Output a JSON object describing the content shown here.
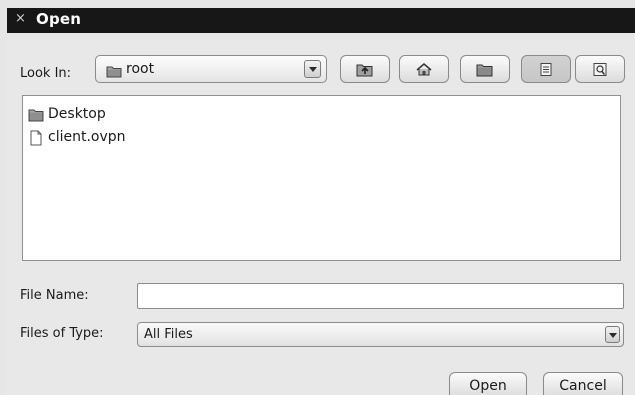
{
  "window": {
    "close_glyph": "×",
    "title": "Open"
  },
  "toolbar": {
    "look_in_label": "Look In:",
    "look_in_value": "root",
    "look_in_icon": "folder-icon",
    "buttons": [
      {
        "name": "up-one-level-button",
        "icon": "folder-up-icon"
      },
      {
        "name": "home-button",
        "icon": "home-icon"
      },
      {
        "name": "new-folder-button",
        "icon": "new-folder-icon"
      },
      {
        "name": "list-view-button",
        "icon": "list-view-icon",
        "pressed": true
      },
      {
        "name": "details-view-button",
        "icon": "details-view-icon"
      }
    ]
  },
  "files": [
    {
      "name": "Desktop",
      "icon": "folder-icon"
    },
    {
      "name": "client.ovpn",
      "icon": "file-icon"
    }
  ],
  "form": {
    "file_name_label": "File Name:",
    "file_name_value": "",
    "files_of_type_label": "Files of Type:",
    "files_of_type_value": "All Files"
  },
  "actions": {
    "open_label": "Open",
    "cancel_label": "Cancel"
  },
  "colors": {
    "titlebar": "#171717",
    "dialog_background": "#e8e8e8",
    "list_background": "#ffffff"
  }
}
